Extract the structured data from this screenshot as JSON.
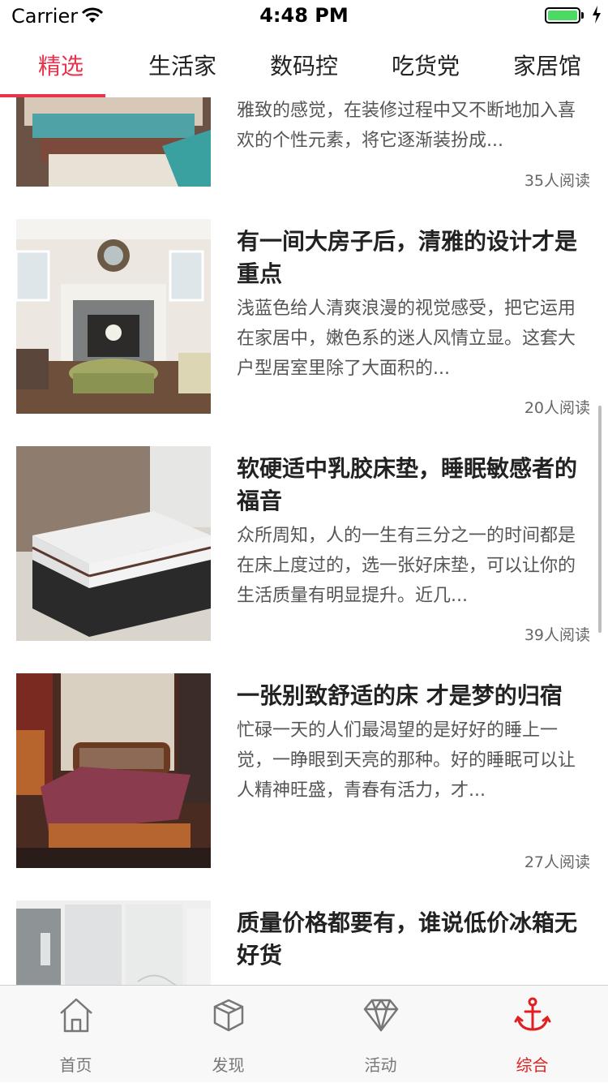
{
  "status_bar": {
    "carrier": "Carrier",
    "time": "4:48 PM",
    "battery_level": 1.0
  },
  "top_tabs": [
    {
      "label": "精选",
      "active": true
    },
    {
      "label": "生活家",
      "active": false
    },
    {
      "label": "数码控",
      "active": false
    },
    {
      "label": "吃货党",
      "active": false
    },
    {
      "label": "家居馆",
      "active": false
    }
  ],
  "articles": [
    {
      "title": "",
      "summary": "雅致的感觉，在装修过程中又不断地加入喜欢的个性元素，将它逐渐装扮成...",
      "reads": "35人阅读",
      "image": "bedroom-bed-photo"
    },
    {
      "title": "有一间大房子后，清雅的设计才是重点",
      "summary": "浅蓝色给人清爽浪漫的视觉感受，把它运用在家居中，嫩色系的迷人风情立显。这套大户型居室里除了大面积的...",
      "reads": "20人阅读",
      "image": "living-room-fireplace-photo"
    },
    {
      "title": "软硬适中乳胶床垫，睡眠敏感者的福音",
      "summary": "众所周知，人的一生有三分之一的时间都是在床上度过的，选一张好床垫，可以让你的生活质量有明显提升。近几...",
      "reads": "39人阅读",
      "image": "latex-mattress-photo"
    },
    {
      "title": "一张别致舒适的床 才是梦的归宿",
      "summary": "忙碌一天的人们最渴望的是好好的睡上一觉，一睁眼到天亮的那种。好的睡眠可以让人精神旺盛，青春有活力，才...",
      "reads": "27人阅读",
      "image": "wooden-bed-photo"
    },
    {
      "title": "质量价格都要有，谁说低价冰箱无好货",
      "summary": "",
      "reads": "",
      "image": "refrigerators-photo"
    }
  ],
  "tab_bar": [
    {
      "label": "首页",
      "icon": "home-icon",
      "active": false
    },
    {
      "label": "发现",
      "icon": "box-icon",
      "active": false
    },
    {
      "label": "活动",
      "icon": "diamond-icon",
      "active": false
    },
    {
      "label": "综合",
      "icon": "anchor-icon",
      "active": true
    }
  ],
  "colors": {
    "accent": "#e8344c",
    "tab_active": "#e02020",
    "text": "#222222",
    "muted": "#555555"
  }
}
